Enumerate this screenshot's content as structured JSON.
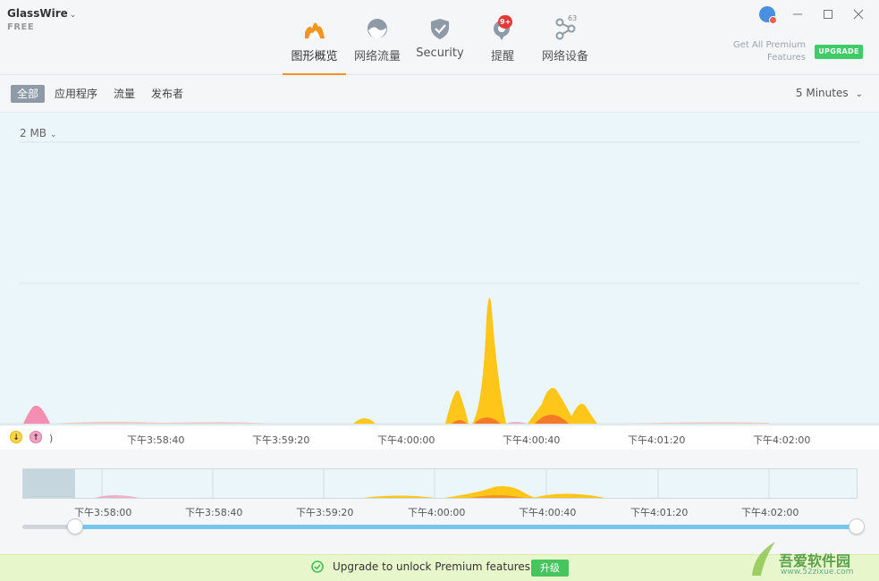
{
  "app": {
    "name": "GlassWire",
    "plan": "FREE"
  },
  "nav": {
    "items": [
      {
        "label": "图形概览",
        "icon": "graph-icon",
        "active": true
      },
      {
        "label": "网络流量",
        "icon": "usage-icon"
      },
      {
        "label": "Security",
        "icon": "shield-icon"
      },
      {
        "label": "提醒",
        "icon": "alerts-icon",
        "badge": "9+"
      },
      {
        "label": "网络设备",
        "icon": "network-devices-icon",
        "count": "63"
      }
    ]
  },
  "premium": {
    "line1": "Get All Premium",
    "line2": "Features",
    "upgrade_label": "UPGRADE"
  },
  "filters": [
    "全部",
    "应用程序",
    "流量",
    "发布者"
  ],
  "time_range": "5 Minutes",
  "graph": {
    "scale": "2 MB"
  },
  "time_ticks": [
    ")",
    "下午3:58:40",
    "下午3:59:20",
    "下午4:00:00",
    "下午4:00:40",
    "下午4:01:20",
    "下午4:02:00"
  ],
  "overview_ticks": [
    "下午3:58:00",
    "下午3:58:40",
    "下午3:59:20",
    "下午4:00:00",
    "下午4:00:40",
    "下午4:01:20",
    "下午4:02:00"
  ],
  "legend": {
    "down": "↓",
    "up": "↑"
  },
  "footer": {
    "message": "Upgrade to unlock Premium features.",
    "button": "升级"
  },
  "watermark": {
    "text": "吾爱软件园",
    "url": "www.52zixue.com"
  },
  "colors": {
    "accent": "#f7941d",
    "download": "#ffc61a",
    "upload": "#f06292",
    "upgrade": "#3ecb68"
  }
}
